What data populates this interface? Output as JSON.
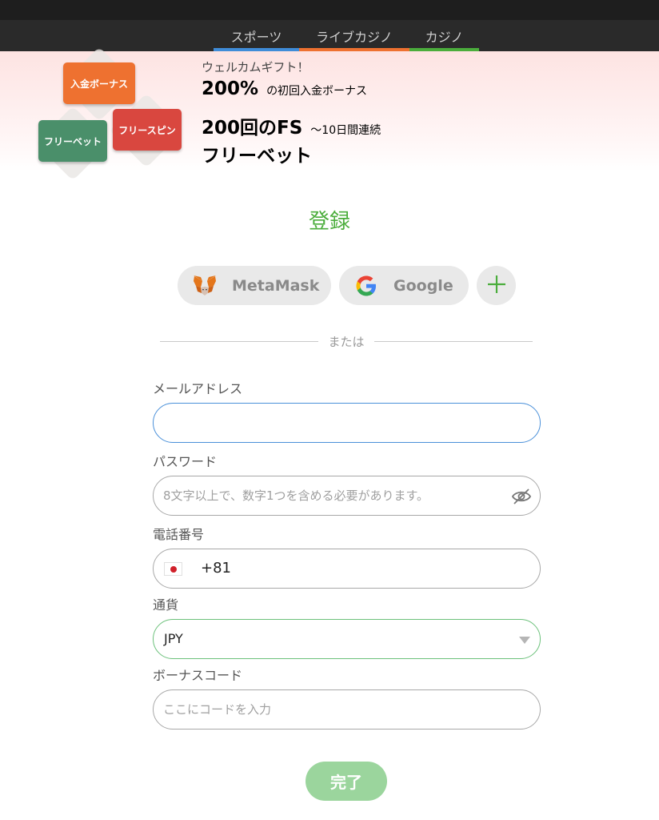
{
  "nav": {
    "tabs": [
      {
        "label": "スポーツ",
        "color": "#3f8cd8"
      },
      {
        "label": "ライブカジノ",
        "color": "#ee7130"
      },
      {
        "label": "カジノ",
        "color": "#4bad3c"
      }
    ]
  },
  "banner": {
    "badges": [
      "入金ボーナス",
      "フリースピン",
      "フリーベット"
    ],
    "welcome": "ウェルカムギフト！",
    "line1_big": "200%",
    "line1_small": "の初回入金ボーナス",
    "line2_big": "200回のFS",
    "line2_small": "～10日間連続",
    "line3_big": "フリーベット"
  },
  "form": {
    "title": "登録",
    "social": {
      "metamask_label": "MetaMask",
      "google_label": "Google"
    },
    "or_text": "または",
    "email": {
      "label": "メールアドレス",
      "value": ""
    },
    "password": {
      "label": "パスワード",
      "placeholder": "8文字以上で、数字1つを含める必要があります。"
    },
    "phone": {
      "label": "電話番号",
      "code": "+81",
      "country": "jp-flag"
    },
    "currency": {
      "label": "通貨",
      "value": "JPY"
    },
    "bonus_code": {
      "label": "ボーナスコード",
      "placeholder": "ここにコードを入力"
    },
    "submit_label": "完了"
  },
  "colors": {
    "accent_green": "#4bad3c",
    "submit_bg": "#9bd59d",
    "email_focus": "#4a90d9"
  }
}
